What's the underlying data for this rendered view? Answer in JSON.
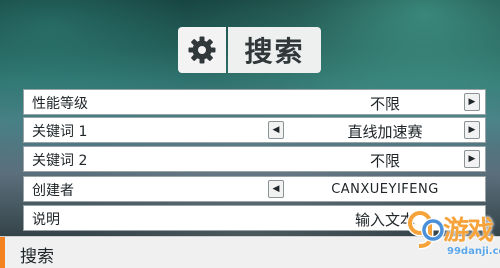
{
  "header": {
    "title": "搜索",
    "icon": "gear-icon"
  },
  "rows": [
    {
      "label": "性能等级",
      "value": "不限",
      "has_left": false,
      "has_right": true
    },
    {
      "label": "关键词 1",
      "value": "直线加速赛",
      "has_left": true,
      "has_right": true
    },
    {
      "label": "关键词 2",
      "value": "不限",
      "has_left": false,
      "has_right": true
    },
    {
      "label": "创建者",
      "value": "CANXUEYIFENG",
      "has_left": true,
      "has_right": false
    },
    {
      "label": "说明",
      "value": "输入文本",
      "has_left": false,
      "has_right": false
    }
  ],
  "arrows": {
    "left": "◀",
    "right": "▶"
  },
  "bottom_bar": {
    "label": "搜索",
    "accent_color": "#f58220"
  },
  "watermark": {
    "text": "游戏",
    "domain": "99danji.com"
  },
  "colors": {
    "header_bg": "#f3f3f3",
    "row_bg": "#ffffff",
    "text": "#1f2528"
  }
}
